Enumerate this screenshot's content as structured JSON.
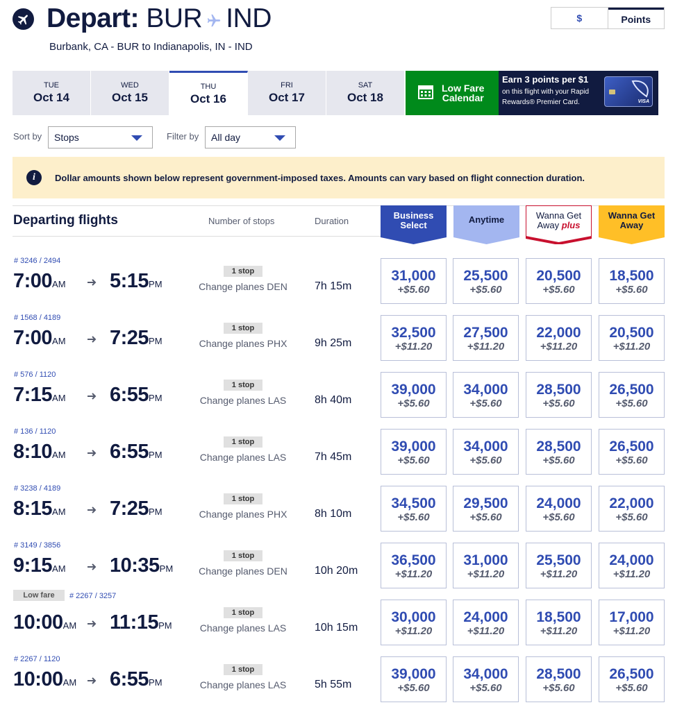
{
  "header": {
    "depart_label": "Depart:",
    "origin": "BUR",
    "destination": "IND",
    "subtitle": "Burbank, CA - BUR to Indianapolis, IN - IND"
  },
  "currency_toggle": {
    "dollar": "$",
    "points": "Points",
    "selected": "Points"
  },
  "date_tabs": [
    {
      "dow": "TUE",
      "date": "Oct 14"
    },
    {
      "dow": "WED",
      "date": "Oct 15"
    },
    {
      "dow": "THU",
      "date": "Oct 16"
    },
    {
      "dow": "FRI",
      "date": "Oct 17"
    },
    {
      "dow": "SAT",
      "date": "Oct 18"
    }
  ],
  "selected_date_index": 2,
  "low_fare_calendar": {
    "line1": "Low Fare",
    "line2": "Calendar"
  },
  "promo": {
    "line1": "Earn 3 points per $1",
    "line2": "on this flight with your Rapid",
    "line3": "Rewards® Premier Card.",
    "card_brand": "VISA"
  },
  "sort": {
    "label": "Sort by",
    "value": "Stops"
  },
  "filter": {
    "label": "Filter by",
    "value": "All day"
  },
  "banner": {
    "text": "Dollar amounts shown below represent government-imposed taxes. Amounts can vary based on flight connection duration."
  },
  "table_header": {
    "title": "Departing flights",
    "stops_col": "Number of stops",
    "duration_col": "Duration",
    "fares": [
      {
        "line1": "Business",
        "line2": "Select",
        "color": "#304cb2",
        "text_color": "#ffffff"
      },
      {
        "line1": "Anytime",
        "line2": "",
        "color": "#a3b6f0",
        "text_color": "#111b40"
      },
      {
        "line1": "Wanna Get",
        "line2": "Away",
        "line2_extra": "plus",
        "color": "#ffffff",
        "text_color": "#111b40",
        "accent": "#c8102e"
      },
      {
        "line1": "Wanna Get",
        "line2": "Away",
        "color": "#ffbf27",
        "text_color": "#111b40"
      }
    ]
  },
  "flights": [
    {
      "nums": "# 3246 / 2494",
      "low_fare": "",
      "dep": "7:00",
      "dep_ap": "AM",
      "arr": "5:15",
      "arr_ap": "PM",
      "stops": "1 stop",
      "change": "Change planes DEN",
      "duration": "7h 15m",
      "fares": [
        {
          "pts": "31,000",
          "tax": "+$5.60"
        },
        {
          "pts": "25,500",
          "tax": "+$5.60"
        },
        {
          "pts": "20,500",
          "tax": "+$5.60"
        },
        {
          "pts": "18,500",
          "tax": "+$5.60"
        }
      ]
    },
    {
      "nums": "# 1568 / 4189",
      "low_fare": "",
      "dep": "7:00",
      "dep_ap": "AM",
      "arr": "7:25",
      "arr_ap": "PM",
      "stops": "1 stop",
      "change": "Change planes PHX",
      "duration": "9h 25m",
      "fares": [
        {
          "pts": "32,500",
          "tax": "+$11.20"
        },
        {
          "pts": "27,500",
          "tax": "+$11.20"
        },
        {
          "pts": "22,000",
          "tax": "+$11.20"
        },
        {
          "pts": "20,500",
          "tax": "+$11.20"
        }
      ]
    },
    {
      "nums": "# 576 / 1120",
      "low_fare": "",
      "dep": "7:15",
      "dep_ap": "AM",
      "arr": "6:55",
      "arr_ap": "PM",
      "stops": "1 stop",
      "change": "Change planes LAS",
      "duration": "8h 40m",
      "fares": [
        {
          "pts": "39,000",
          "tax": "+$5.60"
        },
        {
          "pts": "34,000",
          "tax": "+$5.60"
        },
        {
          "pts": "28,500",
          "tax": "+$5.60"
        },
        {
          "pts": "26,500",
          "tax": "+$5.60"
        }
      ]
    },
    {
      "nums": "# 136 / 1120",
      "low_fare": "",
      "dep": "8:10",
      "dep_ap": "AM",
      "arr": "6:55",
      "arr_ap": "PM",
      "stops": "1 stop",
      "change": "Change planes LAS",
      "duration": "7h 45m",
      "fares": [
        {
          "pts": "39,000",
          "tax": "+$5.60"
        },
        {
          "pts": "34,000",
          "tax": "+$5.60"
        },
        {
          "pts": "28,500",
          "tax": "+$5.60"
        },
        {
          "pts": "26,500",
          "tax": "+$5.60"
        }
      ]
    },
    {
      "nums": "# 3238 / 4189",
      "low_fare": "",
      "dep": "8:15",
      "dep_ap": "AM",
      "arr": "7:25",
      "arr_ap": "PM",
      "stops": "1 stop",
      "change": "Change planes PHX",
      "duration": "8h 10m",
      "fares": [
        {
          "pts": "34,500",
          "tax": "+$5.60"
        },
        {
          "pts": "29,500",
          "tax": "+$5.60"
        },
        {
          "pts": "24,000",
          "tax": "+$5.60"
        },
        {
          "pts": "22,000",
          "tax": "+$5.60"
        }
      ]
    },
    {
      "nums": "# 3149 / 3856",
      "low_fare": "",
      "dep": "9:15",
      "dep_ap": "AM",
      "arr": "10:35",
      "arr_ap": "PM",
      "stops": "1 stop",
      "change": "Change planes DEN",
      "duration": "10h 20m",
      "fares": [
        {
          "pts": "36,500",
          "tax": "+$11.20"
        },
        {
          "pts": "31,000",
          "tax": "+$11.20"
        },
        {
          "pts": "25,500",
          "tax": "+$11.20"
        },
        {
          "pts": "24,000",
          "tax": "+$11.20"
        }
      ]
    },
    {
      "nums": "# 2267 / 3257",
      "low_fare": "Low fare",
      "dep": "10:00",
      "dep_ap": "AM",
      "arr": "11:15",
      "arr_ap": "PM",
      "stops": "1 stop",
      "change": "Change planes LAS",
      "duration": "10h 15m",
      "fares": [
        {
          "pts": "30,000",
          "tax": "+$11.20"
        },
        {
          "pts": "24,000",
          "tax": "+$11.20"
        },
        {
          "pts": "18,500",
          "tax": "+$11.20"
        },
        {
          "pts": "17,000",
          "tax": "+$11.20"
        }
      ]
    },
    {
      "nums": "# 2267 / 1120",
      "low_fare": "",
      "dep": "10:00",
      "dep_ap": "AM",
      "arr": "6:55",
      "arr_ap": "PM",
      "stops": "1 stop",
      "change": "Change planes LAS",
      "duration": "5h 55m",
      "fares": [
        {
          "pts": "39,000",
          "tax": "+$5.60"
        },
        {
          "pts": "34,000",
          "tax": "+$5.60"
        },
        {
          "pts": "28,500",
          "tax": "+$5.60"
        },
        {
          "pts": "26,500",
          "tax": "+$5.60"
        }
      ]
    }
  ]
}
